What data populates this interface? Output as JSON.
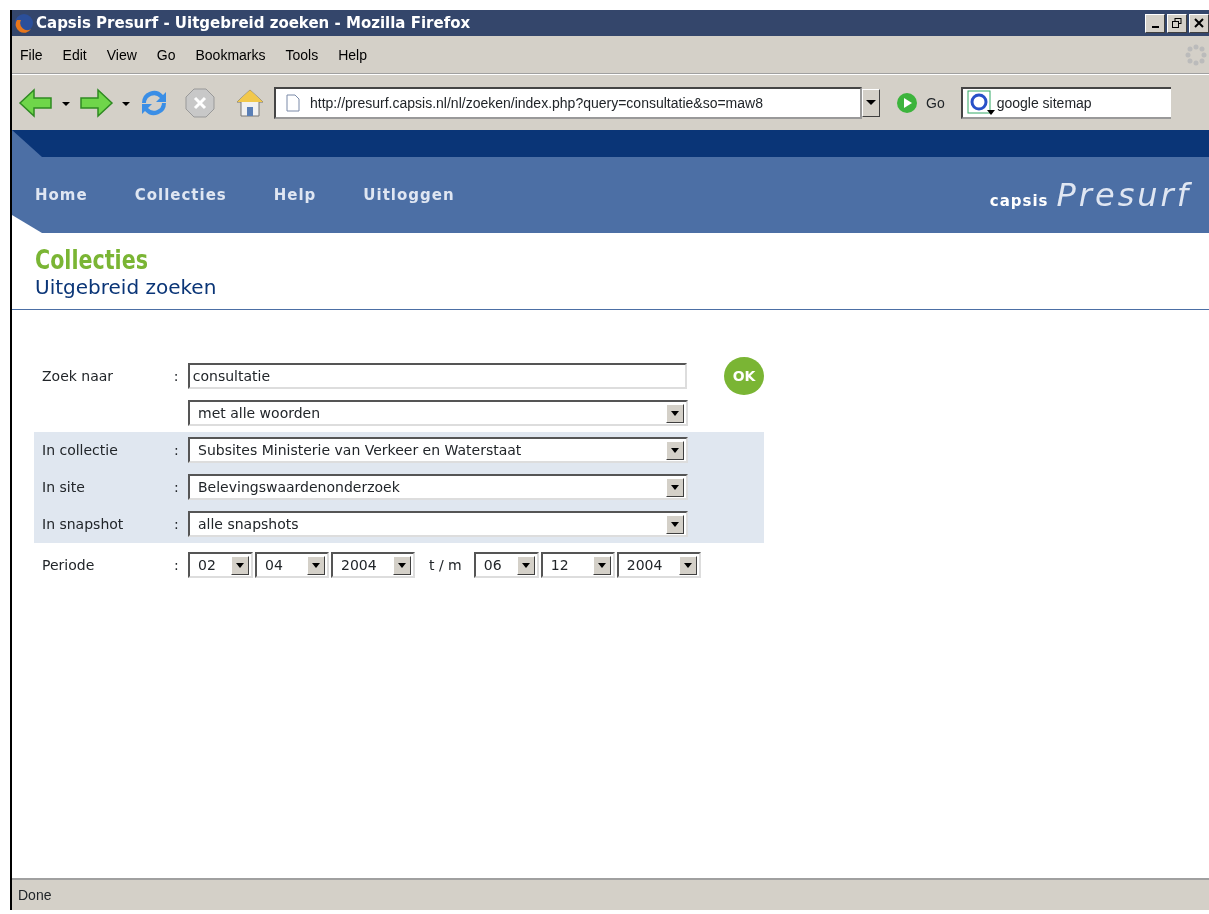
{
  "window": {
    "title": "Capsis Presurf - Uitgebreid zoeken - Mozilla Firefox"
  },
  "menu": [
    "File",
    "Edit",
    "View",
    "Go",
    "Bookmarks",
    "Tools",
    "Help"
  ],
  "toolbar": {
    "url": "http://presurf.capsis.nl/nl/zoeken/index.php?query=consultatie&so=maw8",
    "go": "Go",
    "search": "google sitemap"
  },
  "site_nav": [
    "Home",
    "Collecties",
    "Help",
    "Uitloggen"
  ],
  "logo": {
    "brand": "capsis",
    "product": "Presurf"
  },
  "heading": "Collecties",
  "subheading": "Uitgebreid zoeken",
  "form": {
    "rows": [
      {
        "kind": "text",
        "label": "Zoek naar",
        "colon": ":",
        "value": "consultatie",
        "shaded": false
      },
      {
        "kind": "select",
        "value": "met alle woorden",
        "shaded": false
      },
      {
        "kind": "select",
        "label": "In collectie",
        "colon": ":",
        "value": "Subsites Ministerie van Verkeer en Waterstaat",
        "shaded": true
      },
      {
        "kind": "select",
        "label": "In site",
        "colon": ":",
        "value": "Belevingswaardenonderzoek",
        "shaded": true
      },
      {
        "kind": "select",
        "label": "In snapshot",
        "colon": ":",
        "value": "alle snapshots",
        "shaded": true
      },
      {
        "kind": "period",
        "label": "Periode",
        "colon": ":",
        "from": [
          "02",
          "04",
          "2004"
        ],
        "separator": "t / m",
        "to": [
          "06",
          "12",
          "2004"
        ],
        "shaded": false
      }
    ],
    "ok": "OK"
  },
  "status_bar": "Done"
}
